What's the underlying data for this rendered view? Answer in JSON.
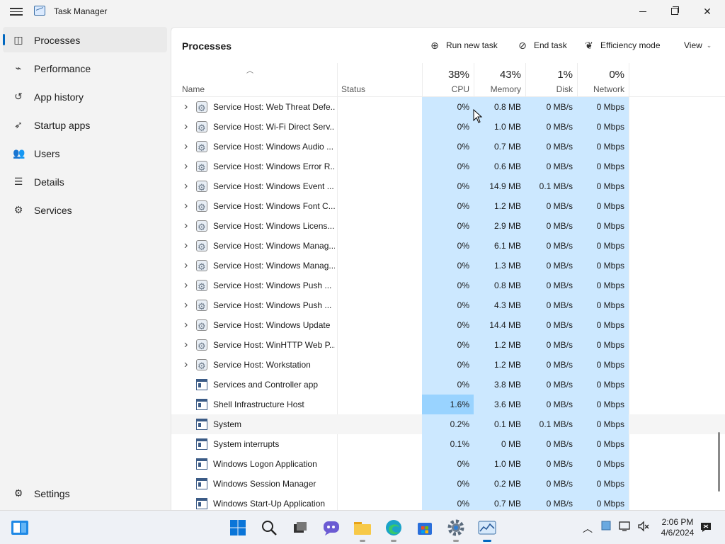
{
  "window": {
    "title": "Task Manager"
  },
  "sidebar": {
    "items": [
      {
        "label": "Processes",
        "icon": "grid-icon",
        "active": true
      },
      {
        "label": "Performance",
        "icon": "performance-icon"
      },
      {
        "label": "App history",
        "icon": "history-icon"
      },
      {
        "label": "Startup apps",
        "icon": "startup-icon"
      },
      {
        "label": "Users",
        "icon": "users-icon"
      },
      {
        "label": "Details",
        "icon": "details-icon"
      },
      {
        "label": "Services",
        "icon": "services-icon"
      }
    ],
    "settings_label": "Settings"
  },
  "toolbar": {
    "title": "Processes",
    "run_new_task": "Run new task",
    "end_task": "End task",
    "efficiency_mode": "Efficiency mode",
    "view": "View"
  },
  "columns": {
    "name": "Name",
    "status": "Status",
    "cpu": {
      "label": "CPU",
      "pct": "38%"
    },
    "memory": {
      "label": "Memory",
      "pct": "43%"
    },
    "disk": {
      "label": "Disk",
      "pct": "1%"
    },
    "network": {
      "label": "Network",
      "pct": "0%"
    }
  },
  "rows": [
    {
      "name": "Service Host: Web Threat Defe...",
      "icon": "gear",
      "expand": true,
      "cpu": "0%",
      "mem": "0.8 MB",
      "disk": "0 MB/s",
      "net": "0 Mbps"
    },
    {
      "name": "Service Host: Wi-Fi Direct Serv...",
      "icon": "gear",
      "expand": true,
      "cpu": "0%",
      "mem": "1.0 MB",
      "disk": "0 MB/s",
      "net": "0 Mbps"
    },
    {
      "name": "Service Host: Windows Audio ...",
      "icon": "gear",
      "expand": true,
      "cpu": "0%",
      "mem": "0.7 MB",
      "disk": "0 MB/s",
      "net": "0 Mbps"
    },
    {
      "name": "Service Host: Windows Error R...",
      "icon": "gear",
      "expand": true,
      "cpu": "0%",
      "mem": "0.6 MB",
      "disk": "0 MB/s",
      "net": "0 Mbps"
    },
    {
      "name": "Service Host: Windows Event ...",
      "icon": "gear",
      "expand": true,
      "cpu": "0%",
      "mem": "14.9 MB",
      "disk": "0.1 MB/s",
      "net": "0 Mbps"
    },
    {
      "name": "Service Host: Windows Font C...",
      "icon": "gear",
      "expand": true,
      "cpu": "0%",
      "mem": "1.2 MB",
      "disk": "0 MB/s",
      "net": "0 Mbps"
    },
    {
      "name": "Service Host: Windows Licens...",
      "icon": "gear",
      "expand": true,
      "cpu": "0%",
      "mem": "2.9 MB",
      "disk": "0 MB/s",
      "net": "0 Mbps"
    },
    {
      "name": "Service Host: Windows Manag...",
      "icon": "gear",
      "expand": true,
      "cpu": "0%",
      "mem": "6.1 MB",
      "disk": "0 MB/s",
      "net": "0 Mbps"
    },
    {
      "name": "Service Host: Windows Manag...",
      "icon": "gear",
      "expand": true,
      "cpu": "0%",
      "mem": "1.3 MB",
      "disk": "0 MB/s",
      "net": "0 Mbps"
    },
    {
      "name": "Service Host: Windows Push ...",
      "icon": "gear",
      "expand": true,
      "cpu": "0%",
      "mem": "0.8 MB",
      "disk": "0 MB/s",
      "net": "0 Mbps"
    },
    {
      "name": "Service Host: Windows Push ...",
      "icon": "gear",
      "expand": true,
      "cpu": "0%",
      "mem": "4.3 MB",
      "disk": "0 MB/s",
      "net": "0 Mbps"
    },
    {
      "name": "Service Host: Windows Update",
      "icon": "gear",
      "expand": true,
      "cpu": "0%",
      "mem": "14.4 MB",
      "disk": "0 MB/s",
      "net": "0 Mbps"
    },
    {
      "name": "Service Host: WinHTTP Web P...",
      "icon": "gear",
      "expand": true,
      "cpu": "0%",
      "mem": "1.2 MB",
      "disk": "0 MB/s",
      "net": "0 Mbps"
    },
    {
      "name": "Service Host: Workstation",
      "icon": "gear",
      "expand": true,
      "cpu": "0%",
      "mem": "1.2 MB",
      "disk": "0 MB/s",
      "net": "0 Mbps"
    },
    {
      "name": "Services and Controller app",
      "icon": "window",
      "expand": false,
      "cpu": "0%",
      "mem": "3.8 MB",
      "disk": "0 MB/s",
      "net": "0 Mbps"
    },
    {
      "name": "Shell Infrastructure Host",
      "icon": "window",
      "expand": false,
      "cpu": "1.6%",
      "cpu_hot": true,
      "mem": "3.6 MB",
      "disk": "0 MB/s",
      "net": "0 Mbps"
    },
    {
      "name": "System",
      "icon": "window",
      "expand": false,
      "highlight": true,
      "cpu": "0.2%",
      "mem": "0.1 MB",
      "disk": "0.1 MB/s",
      "net": "0 Mbps"
    },
    {
      "name": "System interrupts",
      "icon": "window",
      "expand": false,
      "cpu": "0.1%",
      "mem": "0 MB",
      "disk": "0 MB/s",
      "net": "0 Mbps"
    },
    {
      "name": "Windows Logon Application",
      "icon": "window",
      "expand": false,
      "cpu": "0%",
      "mem": "1.0 MB",
      "disk": "0 MB/s",
      "net": "0 Mbps"
    },
    {
      "name": "Windows Session Manager",
      "icon": "window",
      "expand": false,
      "cpu": "0%",
      "mem": "0.2 MB",
      "disk": "0 MB/s",
      "net": "0 Mbps"
    },
    {
      "name": "Windows Start-Up Application",
      "icon": "window",
      "expand": false,
      "cpu": "0%",
      "mem": "0.7 MB",
      "disk": "0 MB/s",
      "net": "0 Mbps"
    }
  ],
  "taskbar": {
    "apps": [
      "widgets-icon",
      "start-icon",
      "search-icon",
      "task-view-icon",
      "chat-icon",
      "file-explorer-icon",
      "edge-icon",
      "store-icon",
      "settings-app-icon",
      "task-manager-icon"
    ],
    "clock_time": "2:06 PM",
    "clock_date": "4/6/2024"
  },
  "colors": {
    "accent": "#0067c0",
    "heat_low": "#cce8ff",
    "heat_mid": "#99d3ff"
  }
}
